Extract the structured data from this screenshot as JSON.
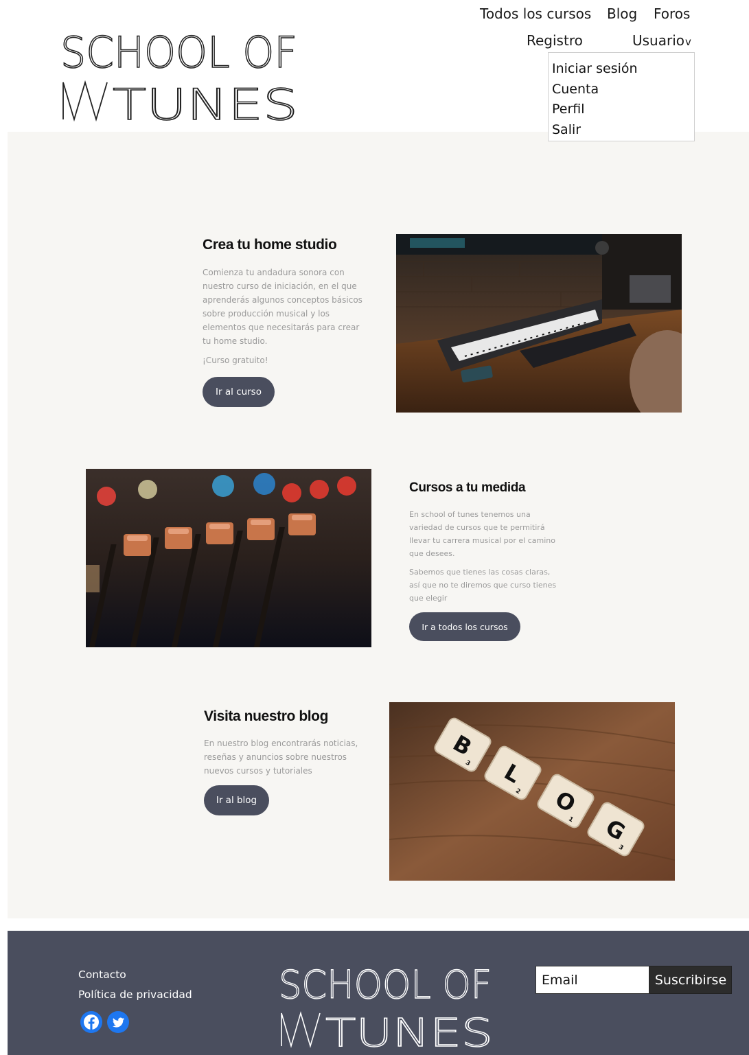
{
  "header": {
    "logo": {
      "line1": "SCHOOL OF",
      "line2": "TUNES"
    },
    "nav": {
      "courses": "Todos los cursos",
      "blog": "Blog",
      "forums": "Foros",
      "register": "Registro",
      "user": "Usuario"
    },
    "user_menu": [
      "Iniciar sesión",
      "Cuenta",
      "Perfil",
      "Salir"
    ]
  },
  "sections": {
    "home_studio": {
      "title": "Crea tu home studio",
      "paragraphs": [
        "Comienza tu andadura sonora con nuestro curso de iniciación, en el que aprenderás algunos conceptos básicos sobre producción musical y los elementos que necesitarás para crear tu home studio.",
        "¡Curso gratuito!"
      ],
      "button": "Ir al curso"
    },
    "courses": {
      "title": "Cursos a tu medida",
      "paragraphs": [
        "En school of tunes tenemos una variedad de cursos que te permitirá llevar tu carrera musical por el camino que desees.",
        "Sabemos que tienes las cosas claras, así que no te diremos que curso tienes que elegir"
      ],
      "button": "Ir a todos los cursos"
    },
    "blog": {
      "title": "Visita nuestro blog",
      "paragraphs": [
        "En nuestro blog encontrarás noticias, reseñas y anuncios sobre nuestros nuevos cursos y tutoriales"
      ],
      "button": "Ir al blog",
      "tiles": [
        "B",
        "L",
        "O",
        "G"
      ],
      "tile_points": [
        "3",
        "2",
        "1",
        "3"
      ]
    }
  },
  "footer": {
    "contact": "Contacto",
    "privacy": "Política de privacidad",
    "social_icons": [
      "facebook-icon",
      "twitter-icon"
    ],
    "email_placeholder": "Email",
    "subscribe": "Suscribirse"
  },
  "colors": {
    "band_bg": "#f7f6f3",
    "button_bg": "#4a4e5e",
    "footer_bg": "#4a4e5e",
    "social_blue": "#1e77f0"
  }
}
